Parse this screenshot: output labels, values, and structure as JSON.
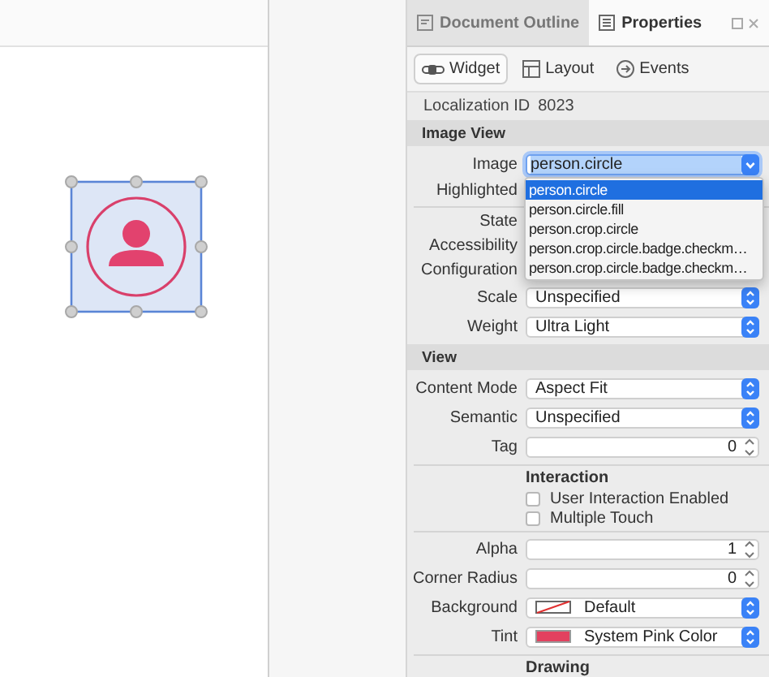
{
  "canvas": {
    "image_view": {
      "selected": true
    }
  },
  "inspector": {
    "tabs": [
      {
        "label": "Document Outline",
        "selected": false
      },
      {
        "label": "Properties",
        "selected": true
      }
    ],
    "segments": [
      {
        "label": "Widget",
        "selected": true
      },
      {
        "label": "Layout",
        "selected": false
      },
      {
        "label": "Events",
        "selected": false
      }
    ],
    "localization": {
      "label": "Localization ID",
      "value": "8023"
    },
    "sections": [
      {
        "title": "Image View",
        "rows": [
          {
            "kind": "combo",
            "label": "Image",
            "value": "person.circle",
            "focused": true
          },
          {
            "kind": "covered",
            "label": "Highlighted"
          },
          {
            "kind": "divider"
          },
          {
            "kind": "covered",
            "label": "State"
          },
          {
            "kind": "covered",
            "label": "Accessibility"
          },
          {
            "kind": "covered",
            "label": "Configuration"
          },
          {
            "kind": "popup",
            "label": "Scale",
            "value": "Unspecified"
          },
          {
            "kind": "popup",
            "label": "Weight",
            "value": "Ultra Light"
          }
        ]
      },
      {
        "title": "View",
        "rows": [
          {
            "kind": "popup",
            "label": "Content Mode",
            "value": "Aspect Fit"
          },
          {
            "kind": "popup",
            "label": "Semantic",
            "value": "Unspecified"
          },
          {
            "kind": "stepper",
            "label": "Tag",
            "value": "0"
          },
          {
            "kind": "divider"
          },
          {
            "kind": "heading",
            "label": "Interaction"
          },
          {
            "kind": "checkbox",
            "label": "User Interaction Enabled",
            "checked": false
          },
          {
            "kind": "checkbox",
            "label": "Multiple Touch",
            "checked": false
          },
          {
            "kind": "divider"
          },
          {
            "kind": "stepper",
            "label": "Alpha",
            "value": "1"
          },
          {
            "kind": "stepper",
            "label": "Corner Radius",
            "value": "0"
          },
          {
            "kind": "color",
            "label": "Background",
            "value": "Default"
          },
          {
            "kind": "color",
            "label": "Tint",
            "value": "System Pink Color",
            "color": "#e2415f"
          },
          {
            "kind": "divider"
          },
          {
            "kind": "heading",
            "label": "Drawing"
          }
        ]
      }
    ],
    "dropdown": {
      "options": [
        {
          "label": "person.circle",
          "selected": true
        },
        {
          "label": "person.circle.fill",
          "selected": false
        },
        {
          "label": "person.crop.circle",
          "selected": false
        },
        {
          "label": "person.crop.circle.badge.checkm…",
          "selected": false
        },
        {
          "label": "person.crop.circle.badge.checkm…",
          "selected": false
        }
      ]
    }
  }
}
